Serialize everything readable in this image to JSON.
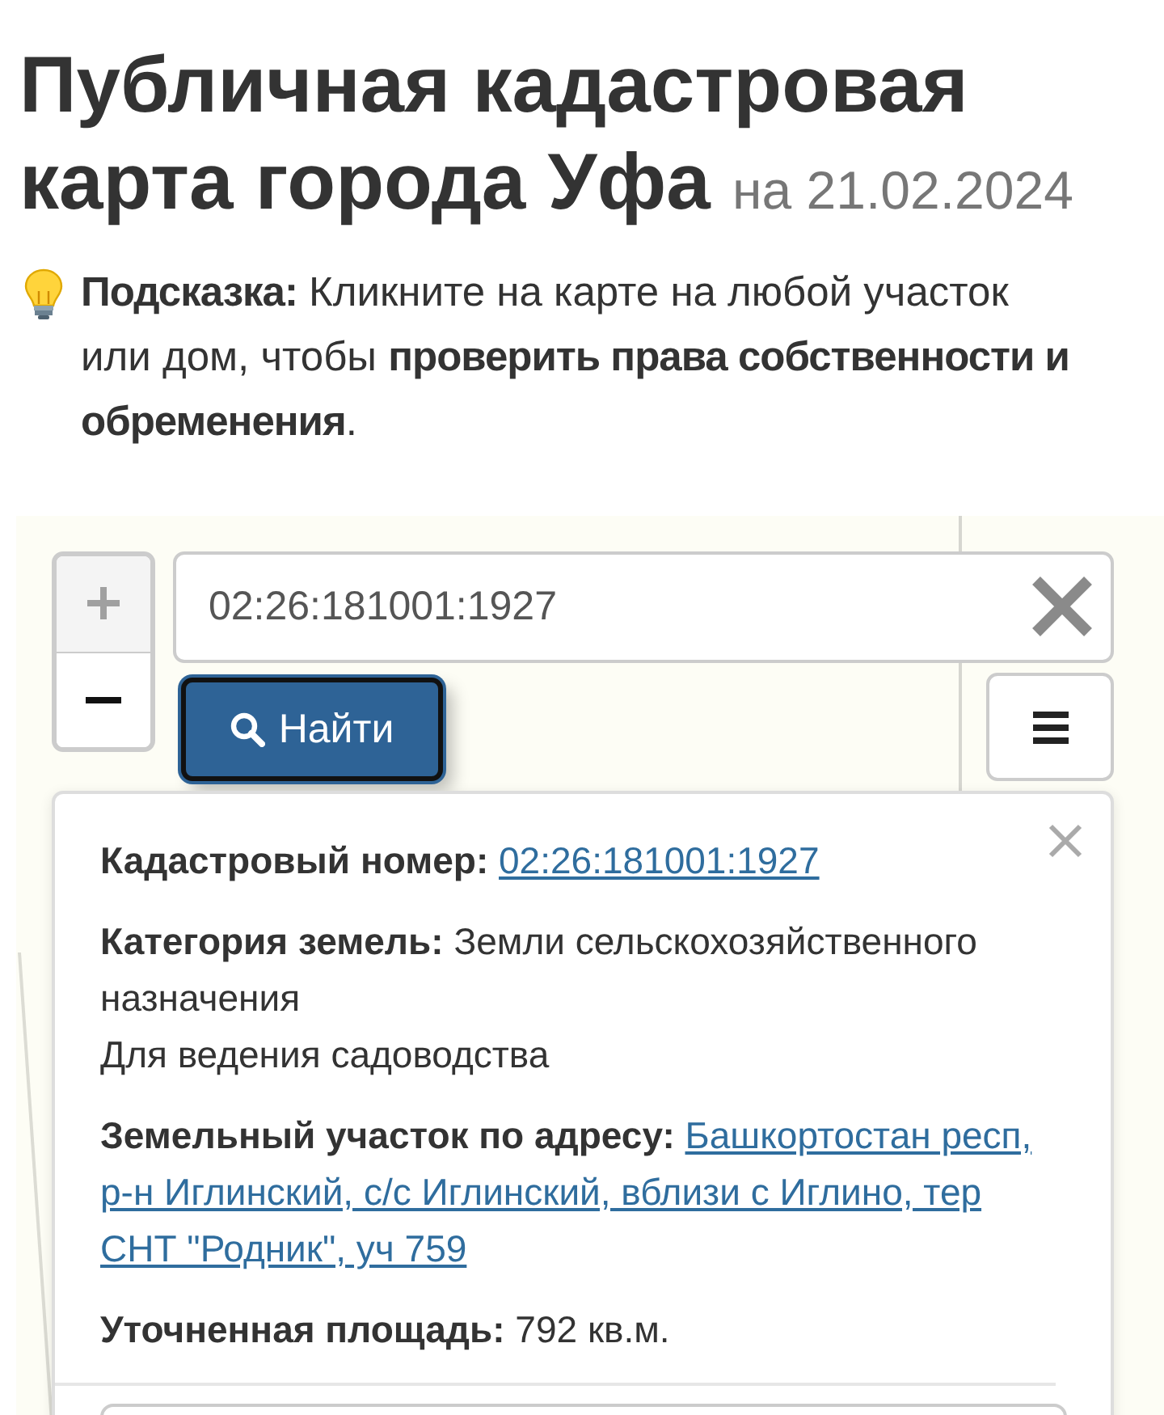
{
  "page": {
    "title": "Публичная кадастровая карта города Уфа",
    "date": "на 21.02.2024"
  },
  "hint": {
    "text": "**Подсказка:** Кликните на карте на любой участок или дом, чтобы **проверить права собственности и обременения**."
  },
  "map": {
    "zoom_controls": [
      {
        "kind": "zoom_in",
        "disabled": true
      },
      {
        "kind": "zoom_out",
        "disabled": false
      }
    ],
    "search": {
      "value": "02:26:181001:1927"
    },
    "find_button": {
      "label": "Найти",
      "focused": true
    },
    "popup": {
      "fields": [
        {
          "kind": "link",
          "label": "Кадастровый номер:",
          "value": "02:26:181001:1927"
        },
        {
          "kind": "text",
          "label": "Категория земель:",
          "value": "Земли сельскохозяйственного назначения",
          "note": "Для ведения садоводства"
        },
        {
          "kind": "link",
          "label": "Земельный участок по адресу:",
          "value": "Башкортостан респ, р-н Иглинский, с/с Иглинский, вблизи с Иглино, тер СНТ \"Родник\", уч 759"
        },
        {
          "kind": "text",
          "label": "Уточненная площадь:",
          "value": "792 кв.м."
        }
      ]
    }
  }
}
